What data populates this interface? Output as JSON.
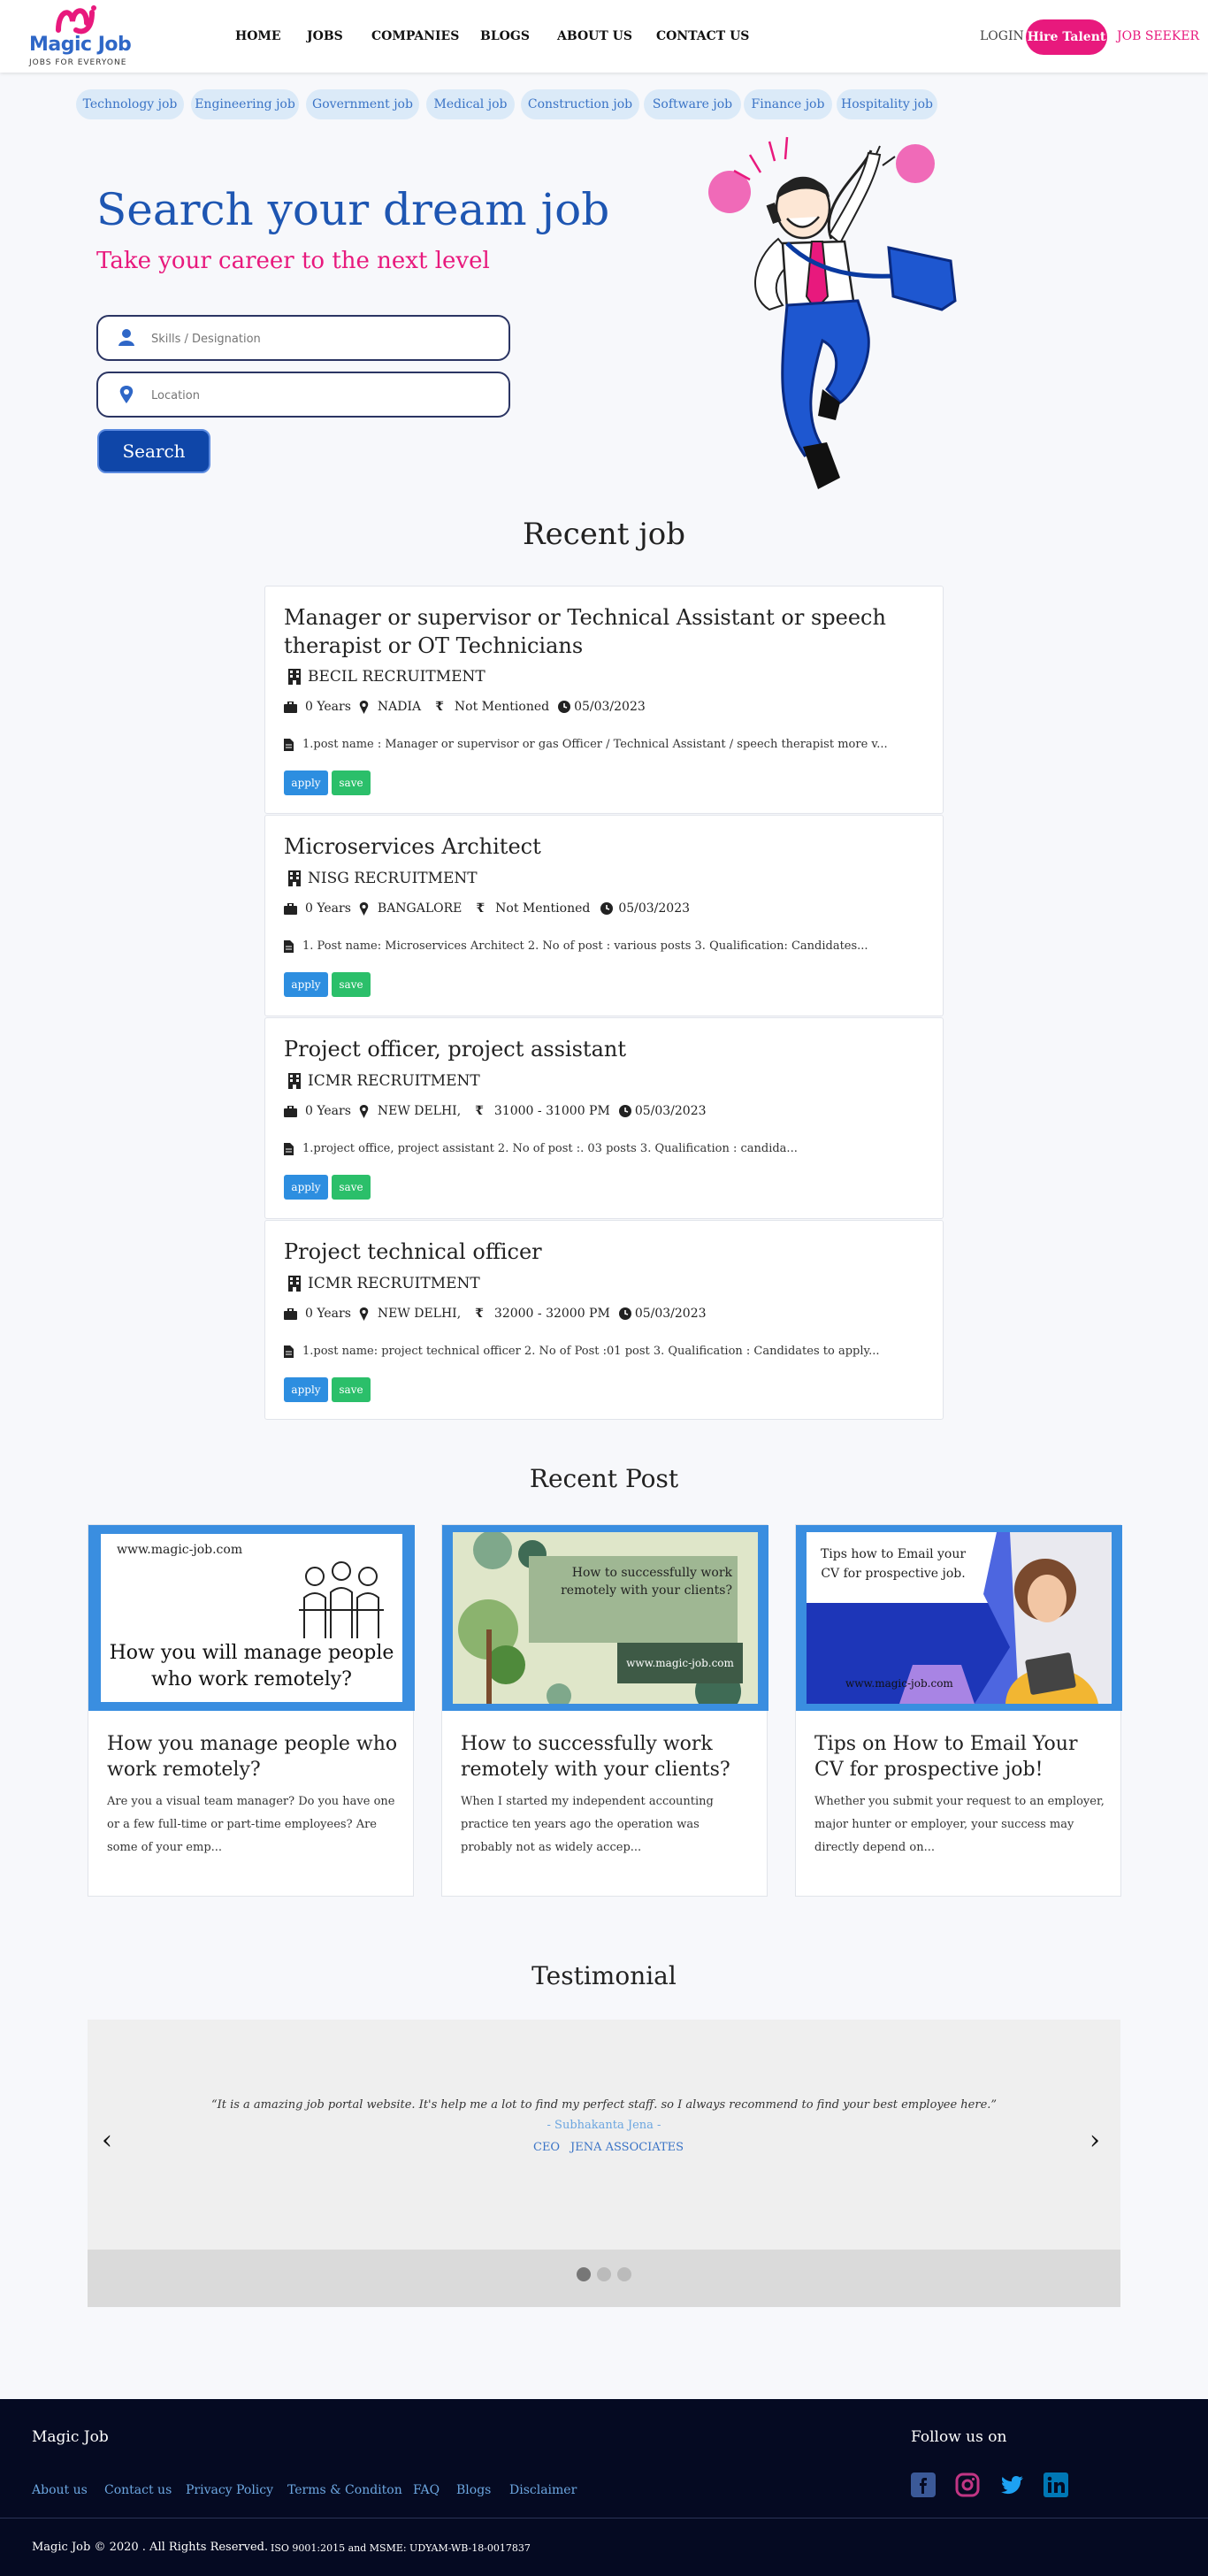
{
  "header": {
    "logo_title": "Magic Job",
    "logo_tagline": "JOBS FOR EVERYONE",
    "nav": [
      "HOME",
      "JOBS",
      "COMPANIES",
      "BLOGS",
      "ABOUT US",
      "CONTACT US"
    ],
    "login": "LOGIN",
    "hire_talent": "Hire Talent",
    "job_seeker": "JOB SEEKER"
  },
  "categories": [
    "Technology job",
    "Engineering job",
    "Government job",
    "Medical job",
    "Construction job",
    "Software job",
    "Finance job",
    "Hospitality job"
  ],
  "hero": {
    "title": "Search your dream job",
    "subtitle": "Take your career to the next level",
    "skills_placeholder": "Skills / Designation",
    "location_placeholder": "Location",
    "search_label": "Search"
  },
  "recent_job": {
    "title": "Recent job",
    "jobs": [
      {
        "title": "Manager or supervisor or Technical Assistant or speech therapist or OT Technicians",
        "company": "BECIL RECRUITMENT",
        "experience": "0 Years",
        "location": "NADIA",
        "salary": "Not Mentioned",
        "date": "05/03/2023",
        "desc": "1.post name : Manager or supervisor or gas Officer / Technical Assistant / speech therapist more v...",
        "apply": "apply",
        "save": "save"
      },
      {
        "title": "Microservices Architect",
        "company": "NISG RECRUITMENT",
        "experience": "0 Years",
        "location": "BANGALORE",
        "salary": "Not Mentioned",
        "date": "05/03/2023",
        "desc": "1. Post name: Microservices Architect 2. No of post : various posts 3. Qualification: Candidates...",
        "apply": "apply",
        "save": "save"
      },
      {
        "title": "Project officer, project assistant",
        "company": "ICMR RECRUITMENT",
        "experience": "0 Years",
        "location": "NEW DELHI,",
        "salary": "31000 - 31000 PM",
        "date": "05/03/2023",
        "desc": "1.project office, project assistant 2. No of post :. 03 posts 3. Qualification : candida...",
        "apply": "apply",
        "save": "save"
      },
      {
        "title": "Project technical officer",
        "company": "ICMR RECRUITMENT",
        "experience": "0 Years",
        "location": "NEW DELHI,",
        "salary": "32000 - 32000 PM",
        "date": "05/03/2023",
        "desc": "1.post name: project technical officer 2. No of Post :01 post 3. Qualification : Candidates to apply...",
        "apply": "apply",
        "save": "save"
      }
    ]
  },
  "recent_post": {
    "title": "Recent Post",
    "posts": [
      {
        "image_site": "www.magic-job.com",
        "image_caption": "How you will manage people who work remotely?",
        "title": "How you manage people who work remotely?",
        "excerpt": "Are you a visual team manager? Do you have one or a few full-time or part-time employees? Are some of your emp..."
      },
      {
        "image_site": "www.magic-job.com",
        "image_caption": "How to successfully work remotely with your clients?",
        "title": "How to successfully work remotely with your clients?",
        "excerpt": "When I started my independent accounting practice ten years ago the operation was probably not as widely accep..."
      },
      {
        "image_site": "www.magic-job.com",
        "image_caption": "Tips how to Email your CV for prospective job.",
        "title": "Tips on How to Email Your CV for prospective job!",
        "excerpt": "Whether you submit your request to an employer, major hunter or employer, your success may directly depend on..."
      }
    ]
  },
  "testimonial": {
    "title": "Testimonial",
    "quote": "“It is a amazing job portal website. It's help me a lot to find my perfect staff. so I always recommend to find your best employee here.”",
    "author": "- Subhakanta Jena -",
    "role": "CEO",
    "company": "JENA ASSOCIATES",
    "prev": "‹",
    "next": "›"
  },
  "footer": {
    "brand": "Magic Job",
    "follow": "Follow us on",
    "links": [
      "About us",
      "Contact us",
      "Privacy Policy",
      "Terms & Conditon",
      "FAQ",
      "Blogs",
      "Disclaimer"
    ],
    "copyright": "Magic Job © 2020 . All Rights Reserved.",
    "iso": "ISO 9001:2015 and MSME: UDYAM-WB-18-0017837",
    "social_icons": [
      "facebook-icon",
      "instagram-icon",
      "twitter-icon",
      "linkedin-icon"
    ]
  },
  "colors": {
    "brand_blue": "#1e56b2",
    "brand_pink": "#e8197d",
    "apply": "#2d8ee0",
    "save": "#2bbf6a",
    "footer_bg": "#050a22"
  }
}
